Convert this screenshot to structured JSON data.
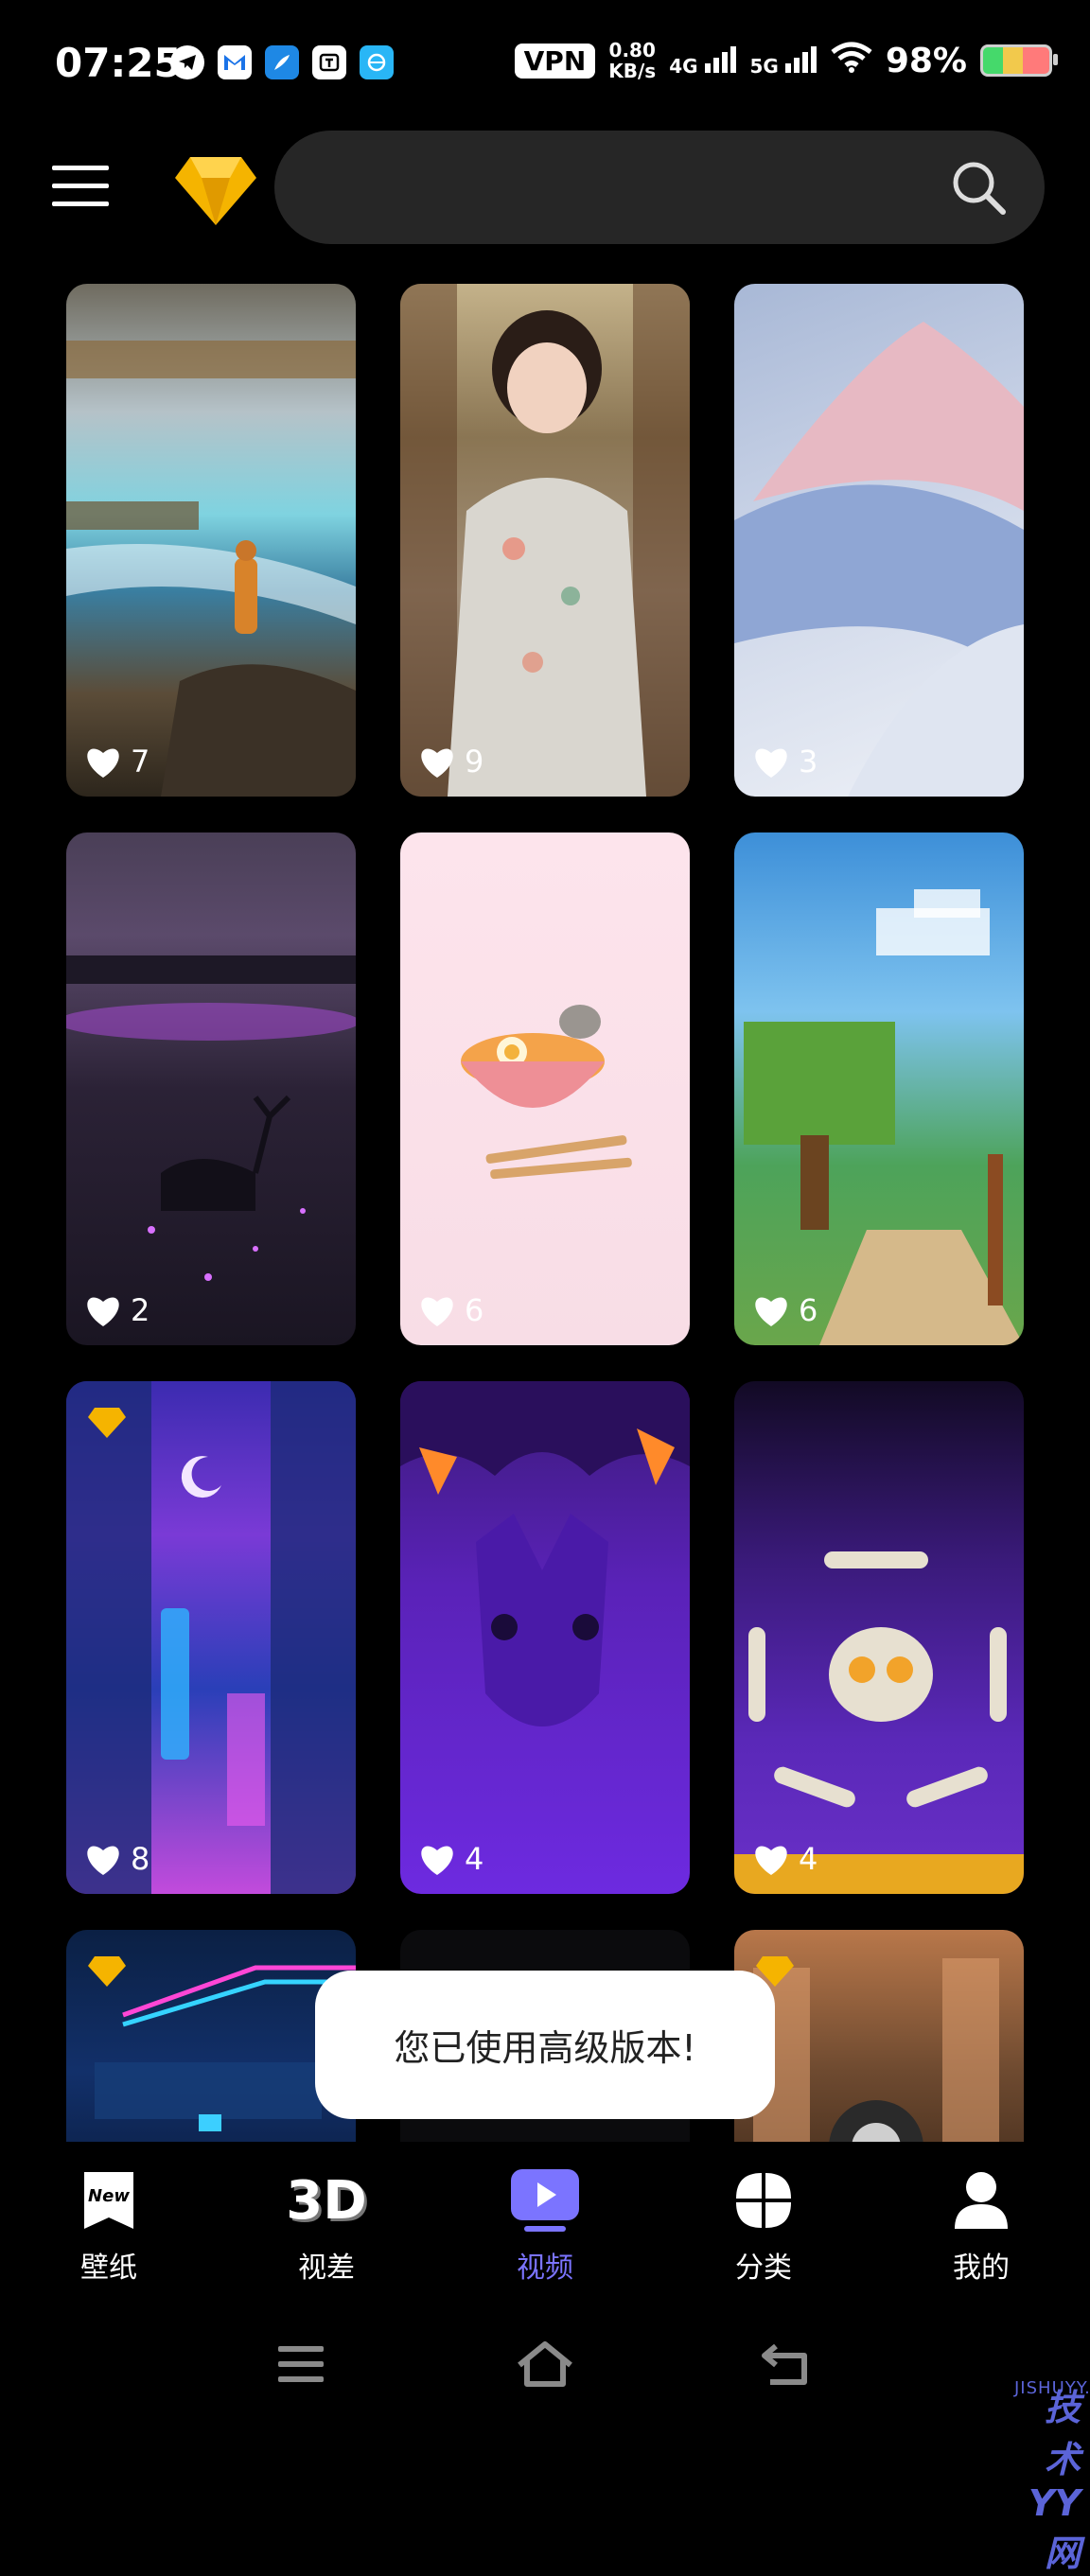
{
  "status_bar": {
    "time": "07:25",
    "vpn": "VPN",
    "speed_value": "0.80",
    "speed_unit": "KB/s",
    "net1": "4G",
    "net2": "5G",
    "battery": "98%"
  },
  "search": {
    "placeholder": ""
  },
  "wallpapers": [
    {
      "likes": "7",
      "premium": false
    },
    {
      "likes": "9",
      "premium": false
    },
    {
      "likes": "3",
      "premium": false
    },
    {
      "likes": "2",
      "premium": false
    },
    {
      "likes": "6",
      "premium": false
    },
    {
      "likes": "6",
      "premium": false
    },
    {
      "likes": "8",
      "premium": true
    },
    {
      "likes": "4",
      "premium": false
    },
    {
      "likes": "4",
      "premium": false
    }
  ],
  "toast": {
    "message": "您已使用高级版本!"
  },
  "nav": {
    "items": [
      {
        "label": "壁纸",
        "icon": "new-badge-icon"
      },
      {
        "label": "视差",
        "icon": "3d-icon"
      },
      {
        "label": "视频",
        "icon": "play-icon",
        "active": true
      },
      {
        "label": "分类",
        "icon": "grid-icon"
      },
      {
        "label": "我的",
        "icon": "person-icon"
      }
    ]
  },
  "brand_badge_text": "New",
  "badge_3d_text": "3D",
  "watermark": {
    "text": "技术YY网",
    "sub": "JISHUYY.COM"
  },
  "colors": {
    "accent": "#7b74ff",
    "vip_gold": "#f5b400",
    "search_bg": "#262626"
  }
}
